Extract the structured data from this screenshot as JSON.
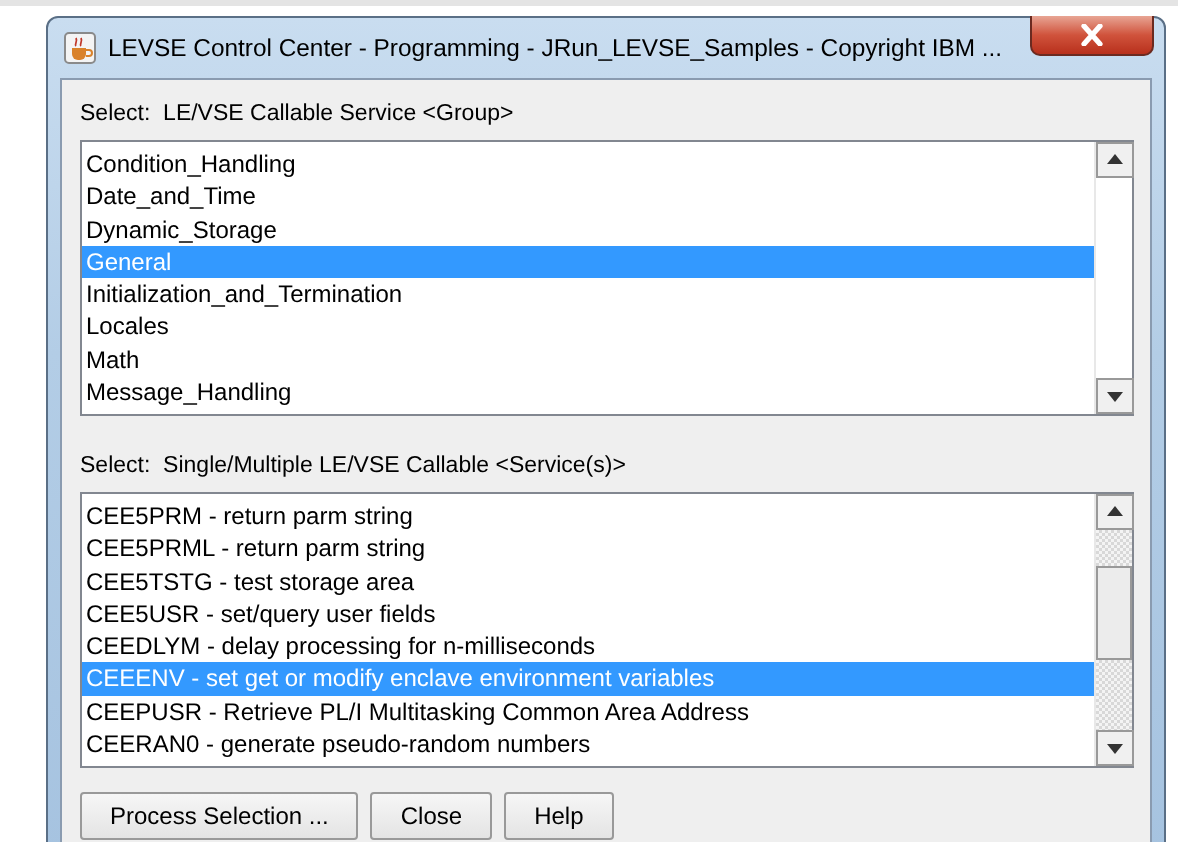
{
  "window": {
    "title": "LEVSE Control Center - Programming - JRun_LEVSE_Samples - Copyright IBM ..."
  },
  "group_list": {
    "label": "Select:  LE/VSE Callable Service <Group>",
    "items": [
      {
        "text": "Condition_Handling",
        "selected": false
      },
      {
        "text": "Date_and_Time",
        "selected": false
      },
      {
        "text": "Dynamic_Storage",
        "selected": false
      },
      {
        "text": "General",
        "selected": true
      },
      {
        "text": "Initialization_and_Termination",
        "selected": false
      },
      {
        "text": "Locales",
        "selected": false
      },
      {
        "text": "Math",
        "selected": false
      },
      {
        "text": "Message_Handling",
        "selected": false
      }
    ]
  },
  "service_list": {
    "label": "Select:  Single/Multiple LE/VSE Callable <Service(s)>",
    "items": [
      {
        "text": "CEE5PRM - return parm string",
        "selected": false
      },
      {
        "text": "CEE5PRML - return parm string",
        "selected": false
      },
      {
        "text": "CEE5TSTG - test storage area",
        "selected": false
      },
      {
        "text": "CEE5USR - set/query user fields",
        "selected": false
      },
      {
        "text": "CEEDLYM - delay processing for n-milliseconds",
        "selected": false
      },
      {
        "text": "CEEENV - set get or modify enclave environment variables",
        "selected": true
      },
      {
        "text": "CEEPUSR - Retrieve PL/I Multitasking Common Area Address",
        "selected": false
      },
      {
        "text": "CEERAN0 - generate pseudo-random numbers",
        "selected": false
      }
    ]
  },
  "buttons": [
    "Process Selection ...",
    "Close",
    "Help"
  ]
}
